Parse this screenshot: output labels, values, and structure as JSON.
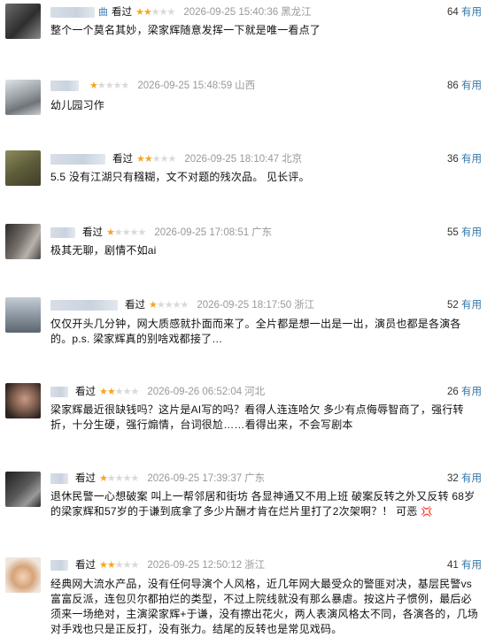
{
  "vote_suffix": "有用",
  "reviews": [
    {
      "user_tail": "曲",
      "status": "看过",
      "stars": 2,
      "time": "2026-09-25 15:40:36",
      "location": "黑龙江",
      "votes": "64",
      "text": "整个一个莫名其妙，梁家辉随意发挥一下就是唯一看点了",
      "avatar_color": "#4f4f4f"
    },
    {
      "user_tail": "",
      "status": "",
      "stars": 1,
      "time": "2026-09-25 15:48:59",
      "location": "山西",
      "votes": "86",
      "text": "幼儿园习作",
      "avatar_color": "#a3a8ad"
    },
    {
      "user_tail": "",
      "status": "看过",
      "stars": 2,
      "time": "2026-09-25 18:10:47",
      "location": "北京",
      "votes": "36",
      "text": "5.5 没有江湖只有糨糊，文不对题的残次品。 见长评。",
      "avatar_color": "#6b6a45"
    },
    {
      "user_tail": "",
      "status": "看过",
      "stars": 1,
      "time": "2026-09-25 17:08:51",
      "location": "广东",
      "votes": "55",
      "text": "极其无聊，剧情不如ai",
      "avatar_color": "#4a4744"
    },
    {
      "user_tail": "",
      "status": "看过",
      "stars": 1,
      "time": "2026-09-25 18:17:50",
      "location": "浙江",
      "votes": "52",
      "text": "仅仅开头几分钟，网大质感就扑面而来了。全片都是想一出是一出，演员也都是各演各的。p.s. 梁家辉真的别啥戏都接了…",
      "avatar_color": "#9aa3ad"
    },
    {
      "user_tail": "",
      "status": "看过",
      "stars": 2,
      "time": "2026-09-26 06:52:04",
      "location": "河北",
      "votes": "26",
      "text": "梁家辉最近很缺钱吗？这片是AI写的吗？看得人连连哈欠 多少有点侮辱智商了，强行转折，十分生硬，强行煽情，台词很尬……看得出来，不会写剧本",
      "avatar_color": "#5e4a40"
    },
    {
      "user_tail": "",
      "status": "看过",
      "stars": 1,
      "time": "2026-09-25 17:39:37",
      "location": "广东",
      "votes": "32",
      "text": "退休民警一心想破案 叫上一帮邻居和街坊 各显神通又不用上班 破案反转之外又反转 68岁的梁家辉和57岁的于谦到底拿了多少片酬才肯在烂片里打了2次架啊？！ 可恶",
      "emoji": "💢",
      "avatar_color": "#3f3f3f"
    },
    {
      "user_tail": "",
      "status": "看过",
      "stars": 2,
      "time": "2026-09-25 12:50:12",
      "location": "浙江",
      "votes": "41",
      "text": "经典网大流水产品，没有任何导演个人风格，近几年网大最受众的警匪对决，基层民警vs富富反派，连包贝尔都拍烂的类型，不过上院线就没有那么暴虐。按这片子惯例，最后必须来一场绝对，主演梁家辉+于谦，没有擦出花火，两人表演风格太不同，各演各的，几场对手戏也只是正反打，没有张力。结尾的反转也是常见戏码。",
      "avatar_color": "#d6a47a"
    }
  ]
}
